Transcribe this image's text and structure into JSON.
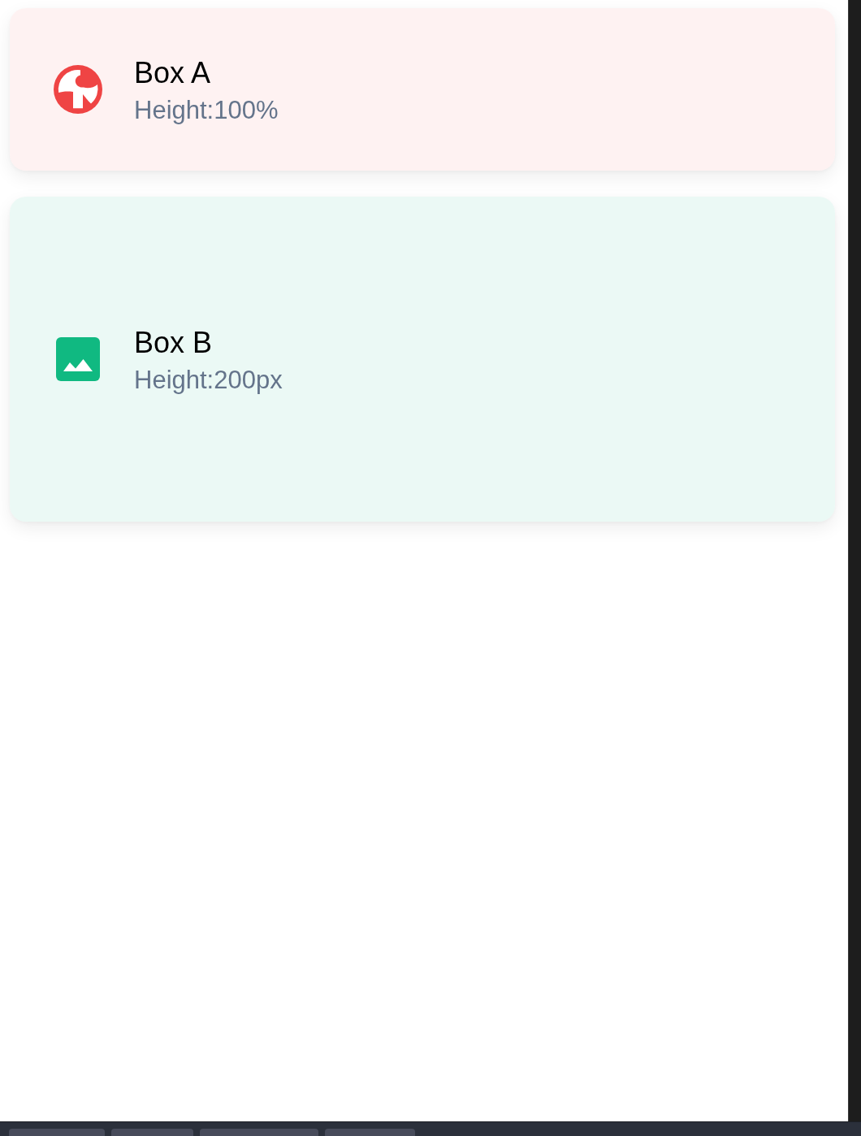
{
  "cards": [
    {
      "kind": "globe",
      "title": "Box A",
      "subtitle": "Height:100%",
      "color": "#ef4444"
    },
    {
      "kind": "image",
      "title": "Box B",
      "subtitle": "Height:200px",
      "color": "#10b981"
    }
  ]
}
